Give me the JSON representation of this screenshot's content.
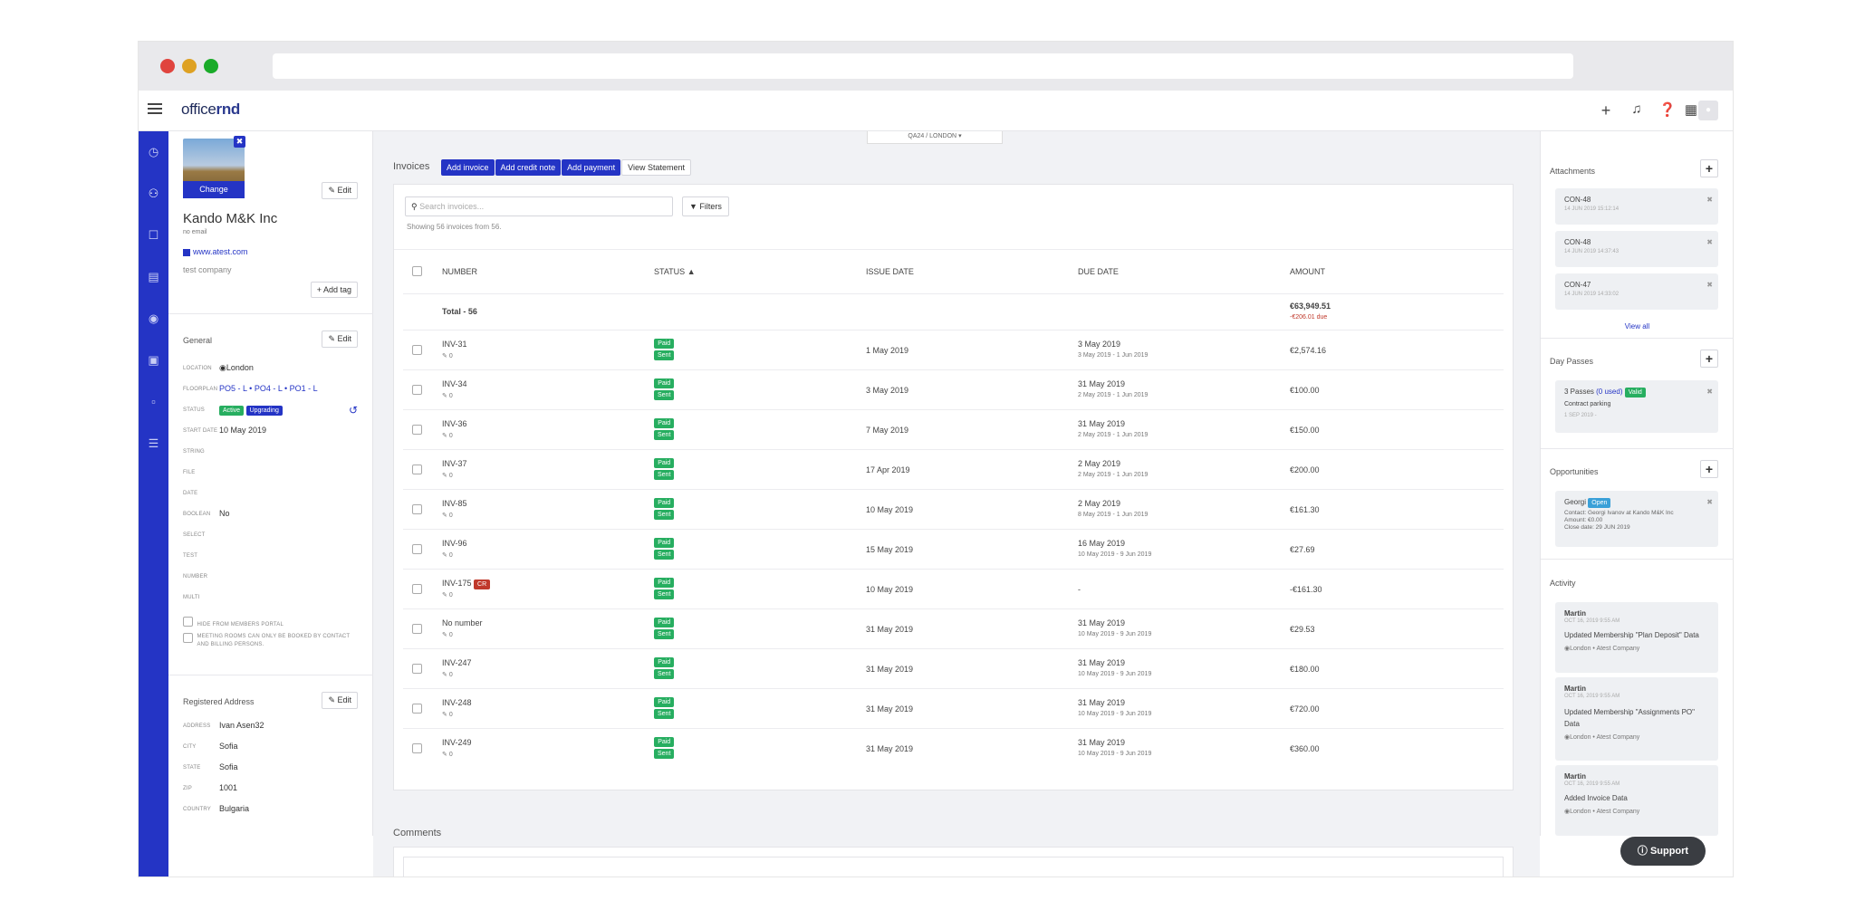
{
  "topbar": {
    "logo_pre": "office",
    "logo_bold": "rnd",
    "icons": [
      "plus-icon",
      "bell-icon",
      "help-icon",
      "apps-icon",
      "user-avatar"
    ]
  },
  "breadcrumb": "QA24  /  LONDON",
  "profile": {
    "change_label": "Change",
    "edit_label": "Edit",
    "name": "Kando M&K Inc",
    "email": "no email",
    "website": "www.atest.com",
    "description": "test company",
    "add_tag": "Add tag",
    "general_title": "General",
    "fields": [
      {
        "label": "LOCATION",
        "value": "London"
      },
      {
        "label": "FLOORPLAN",
        "value": "PO5 - L  •  PO4 - L  •  PO1 - L"
      },
      {
        "label": "STATUS",
        "value": ""
      },
      {
        "label": "START DATE",
        "value": "10 May 2019"
      },
      {
        "label": "STRING",
        "value": ""
      },
      {
        "label": "FILE",
        "value": ""
      },
      {
        "label": "DATE",
        "value": ""
      },
      {
        "label": "BOOLEAN",
        "value": "No"
      },
      {
        "label": "SELECT",
        "value": ""
      },
      {
        "label": "TEST",
        "value": ""
      },
      {
        "label": "NUMBER",
        "value": ""
      },
      {
        "label": "MULTI",
        "value": ""
      }
    ],
    "status_active": "Active",
    "status_upgrading": "Upgrading",
    "hide_portal": "HIDE FROM MEMBERS PORTAL",
    "meeting_rooms": "MEETING ROOMS CAN ONLY BE BOOKED BY CONTACT AND BILLING PERSONS.",
    "address_title": "Registered Address",
    "address": [
      {
        "label": "ADDRESS",
        "value": "Ivan Asen32"
      },
      {
        "label": "CITY",
        "value": "Sofia"
      },
      {
        "label": "STATE",
        "value": "Sofia"
      },
      {
        "label": "ZIP",
        "value": "1001"
      },
      {
        "label": "COUNTRY",
        "value": "Bulgaria"
      }
    ]
  },
  "invoices": {
    "title": "Invoices",
    "add_invoice": "Add invoice",
    "add_credit": "Add credit note",
    "add_payment": "Add payment",
    "view_statement": "View Statement",
    "search_placeholder": "Search invoices...",
    "filters": "Filters",
    "showing": "Showing 56 invoices from 56.",
    "columns": [
      "NUMBER",
      "STATUS",
      "ISSUE DATE",
      "DUE DATE",
      "AMOUNT"
    ],
    "total_label": "Total - 56",
    "total_amount": "€63,949.51",
    "total_due": "-€206.01 due",
    "rows": [
      {
        "number": "INV-31",
        "cr": "",
        "issue": "1 May 2019",
        "due": "3 May 2019",
        "period": "3 May 2019 - 1 Jun 2019",
        "amount": "€2,574.16"
      },
      {
        "number": "INV-34",
        "cr": "",
        "issue": "3 May 2019",
        "due": "31 May 2019",
        "period": "2 May 2019 - 1 Jun 2019",
        "amount": "€100.00"
      },
      {
        "number": "INV-36",
        "cr": "",
        "issue": "7 May 2019",
        "due": "31 May 2019",
        "period": "2 May 2019 - 1 Jun 2019",
        "amount": "€150.00"
      },
      {
        "number": "INV-37",
        "cr": "",
        "issue": "17 Apr 2019",
        "due": "2 May 2019",
        "period": "2 May 2019 - 1 Jun 2019",
        "amount": "€200.00"
      },
      {
        "number": "INV-85",
        "cr": "",
        "issue": "10 May 2019",
        "due": "2 May 2019",
        "period": "8 May 2019 - 1 Jun 2019",
        "amount": "€161.30"
      },
      {
        "number": "INV-96",
        "cr": "",
        "issue": "15 May 2019",
        "due": "16 May 2019",
        "period": "10 May 2019 - 9 Jun 2019",
        "amount": "€27.69"
      },
      {
        "number": "INV-175",
        "cr": "CR",
        "issue": "10 May 2019",
        "due": "-",
        "period": "",
        "amount": "-€161.30"
      },
      {
        "number": "No number",
        "cr": "",
        "issue": "31 May 2019",
        "due": "31 May 2019",
        "period": "10 May 2019 - 9 Jun 2019",
        "amount": "€29.53"
      },
      {
        "number": "INV-247",
        "cr": "",
        "issue": "31 May 2019",
        "due": "31 May 2019",
        "period": "10 May 2019 - 9 Jun 2019",
        "amount": "€180.00"
      },
      {
        "number": "INV-248",
        "cr": "",
        "issue": "31 May 2019",
        "due": "31 May 2019",
        "period": "10 May 2019 - 9 Jun 2019",
        "amount": "€720.00"
      },
      {
        "number": "INV-249",
        "cr": "",
        "issue": "31 May 2019",
        "due": "31 May 2019",
        "period": "10 May 2019 - 9 Jun 2019",
        "amount": "€360.00"
      }
    ],
    "paid": "Paid",
    "sent": "Sent",
    "comments_count": "0"
  },
  "comments_title": "Comments",
  "right": {
    "attachments_title": "Attachments",
    "attachments": [
      {
        "name": "CON-48",
        "date": "14 JUN 2019 15:12:14"
      },
      {
        "name": "CON-48",
        "date": "14 JUN 2019 14:37:43"
      },
      {
        "name": "CON-47",
        "date": "14 JUN 2019 14:33:02"
      }
    ],
    "view_all": "View all",
    "day_passes_title": "Day Passes",
    "day_pass": {
      "count": "3 Passes",
      "used": "(0 used)",
      "badge": "Valid",
      "desc": "Contract parking",
      "date": "1 SEP 2019 -"
    },
    "opportunities_title": "Opportunities",
    "opportunity": {
      "name": "Georgi",
      "badge": "Open",
      "contact": "Contact: Georgi Ivanov at Kando M&K Inc",
      "amount": "Amount: €0.00",
      "close": "Close date: 29 JUN 2019"
    },
    "activity_title": "Activity",
    "activity": [
      {
        "user": "Martin",
        "date": "OCT 16, 2019 9:55 AM",
        "text": "Updated Membership \"Plan Deposit\" Data",
        "loc": "London",
        "company": "Atest Company"
      },
      {
        "user": "Martin",
        "date": "OCT 16, 2019 9:55 AM",
        "text": "Updated Membership \"Assignments PO\" Data",
        "loc": "London",
        "company": "Atest Company"
      },
      {
        "user": "Martin",
        "date": "OCT 16, 2019 9:55 AM",
        "text": "Added Invoice Data",
        "loc": "London",
        "company": "Atest Company"
      }
    ]
  },
  "support_label": "Support",
  "colors": {
    "accent": "#2434c5",
    "paid": "#27ae60",
    "cr": "#c0392b",
    "open": "#3aa0d8"
  }
}
